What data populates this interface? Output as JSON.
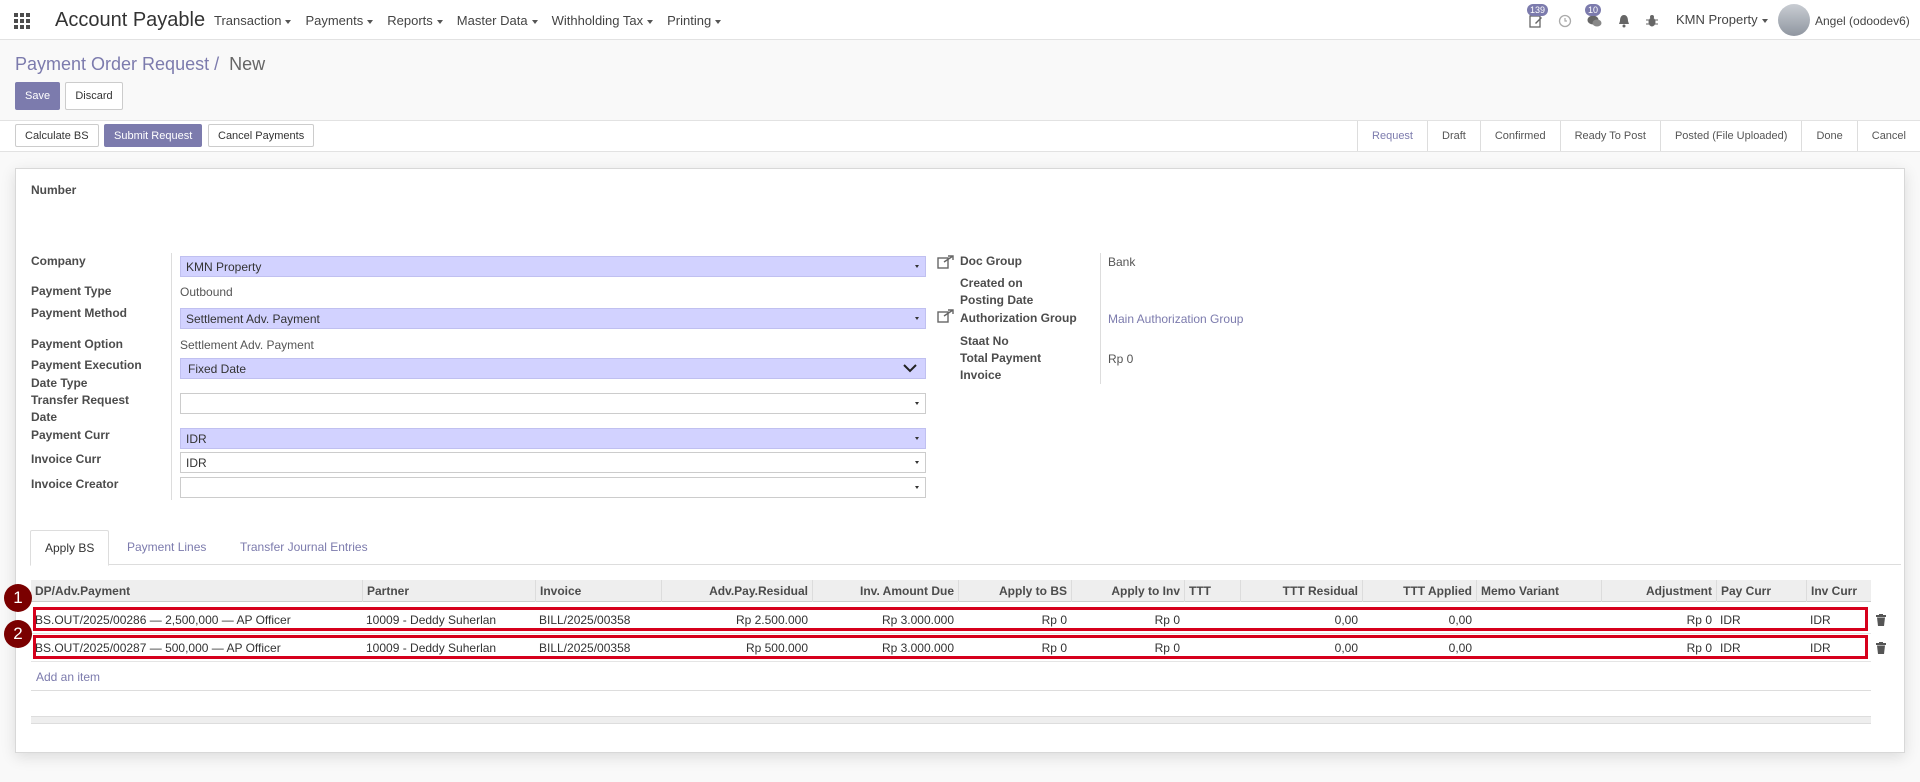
{
  "nav": {
    "app_title": "Account Payable",
    "menu": [
      "Transaction",
      "Payments",
      "Reports",
      "Master Data",
      "Withholding Tax",
      "Printing"
    ],
    "activity_badge": "139",
    "message_badge": "10",
    "company": "KMN Property",
    "user": "Angel (odoodev6)"
  },
  "breadcrumb": {
    "parent": "Payment Order Request",
    "sep": "/",
    "current": "New"
  },
  "buttons": {
    "save": "Save",
    "discard": "Discard"
  },
  "actions": {
    "calc": "Calculate BS",
    "submit": "Submit Request",
    "cancel": "Cancel Payments"
  },
  "stages": [
    "Request",
    "Draft",
    "Confirmed",
    "Ready To Post",
    "Posted (File Uploaded)",
    "Done",
    "Cancel"
  ],
  "form": {
    "number_label": "Number",
    "left": {
      "company": {
        "label": "Company",
        "value": "KMN Property"
      },
      "payment_type": {
        "label": "Payment Type",
        "value": "Outbound"
      },
      "payment_method": {
        "label": "Payment Method",
        "value": "Settlement Adv. Payment"
      },
      "payment_option": {
        "label": "Payment Option",
        "value": "Settlement Adv. Payment"
      },
      "exec_date_type": {
        "label_1": "Payment Execution",
        "label_2": "Date Type",
        "value": "Fixed Date"
      },
      "transfer_req_date": {
        "label_1": "Transfer Request",
        "label_2": "Date",
        "value": ""
      },
      "payment_curr": {
        "label": "Payment Curr",
        "value": "IDR"
      },
      "invoice_curr": {
        "label": "Invoice Curr",
        "value": "IDR"
      },
      "invoice_creator": {
        "label": "Invoice Creator",
        "value": ""
      }
    },
    "right": {
      "doc_group": {
        "label": "Doc Group",
        "value": "Bank"
      },
      "created_on": {
        "label": "Created on"
      },
      "posting_date": {
        "label": "Posting Date"
      },
      "auth_group": {
        "label": "Authorization Group",
        "value": "Main Authorization Group"
      },
      "staat_no": {
        "label": "Staat No"
      },
      "total_payment": {
        "label": "Total Payment",
        "value": "Rp 0"
      },
      "invoice": {
        "label": "Invoice"
      }
    }
  },
  "tabs": [
    "Apply BS",
    "Payment Lines",
    "Transfer Journal Entries"
  ],
  "table": {
    "columns": [
      "DP/Adv.Payment",
      "Partner",
      "Invoice",
      "Adv.Pay.Residual",
      "Inv. Amount Due",
      "Apply to BS",
      "Apply to Inv",
      "TTT",
      "TTT Residual",
      "TTT Applied",
      "Memo Variant",
      "Adjustment",
      "Pay Curr",
      "Inv Curr"
    ],
    "rows": [
      {
        "marker": "1",
        "dp": "BS.OUT/2025/00286 — 2,500,000 — AP Officer",
        "partner": "10009 - Deddy Suherlan",
        "invoice": "BILL/2025/00358",
        "adv_residual": "Rp 2.500.000",
        "inv_due": "Rp 3.000.000",
        "apply_bs": "Rp 0",
        "apply_inv": "Rp 0",
        "ttt": "",
        "ttt_residual": "0,00",
        "ttt_applied": "0,00",
        "memo": "",
        "adjustment": "Rp 0",
        "pay_curr": "IDR",
        "inv_curr": "IDR"
      },
      {
        "marker": "2",
        "dp": "BS.OUT/2025/00287 — 500,000 — AP Officer",
        "partner": "10009 - Deddy Suherlan",
        "invoice": "BILL/2025/00358",
        "adv_residual": "Rp 500.000",
        "inv_due": "Rp 3.000.000",
        "apply_bs": "Rp 0",
        "apply_inv": "Rp 0",
        "ttt": "",
        "ttt_residual": "0,00",
        "ttt_applied": "0,00",
        "memo": "",
        "adjustment": "Rp 0",
        "pay_curr": "IDR",
        "inv_curr": "IDR"
      }
    ],
    "add_item": "Add an item"
  },
  "colors": {
    "brand": "#7c7bad",
    "required_field": "#d2d2ff",
    "highlight": "#d6001c",
    "marker": "#7a0000"
  },
  "icons": [
    "apps-grid-icon",
    "activity-edit-icon",
    "clock-icon",
    "chat-icon",
    "bell-icon",
    "bug-icon",
    "external-link-icon",
    "trash-icon"
  ]
}
